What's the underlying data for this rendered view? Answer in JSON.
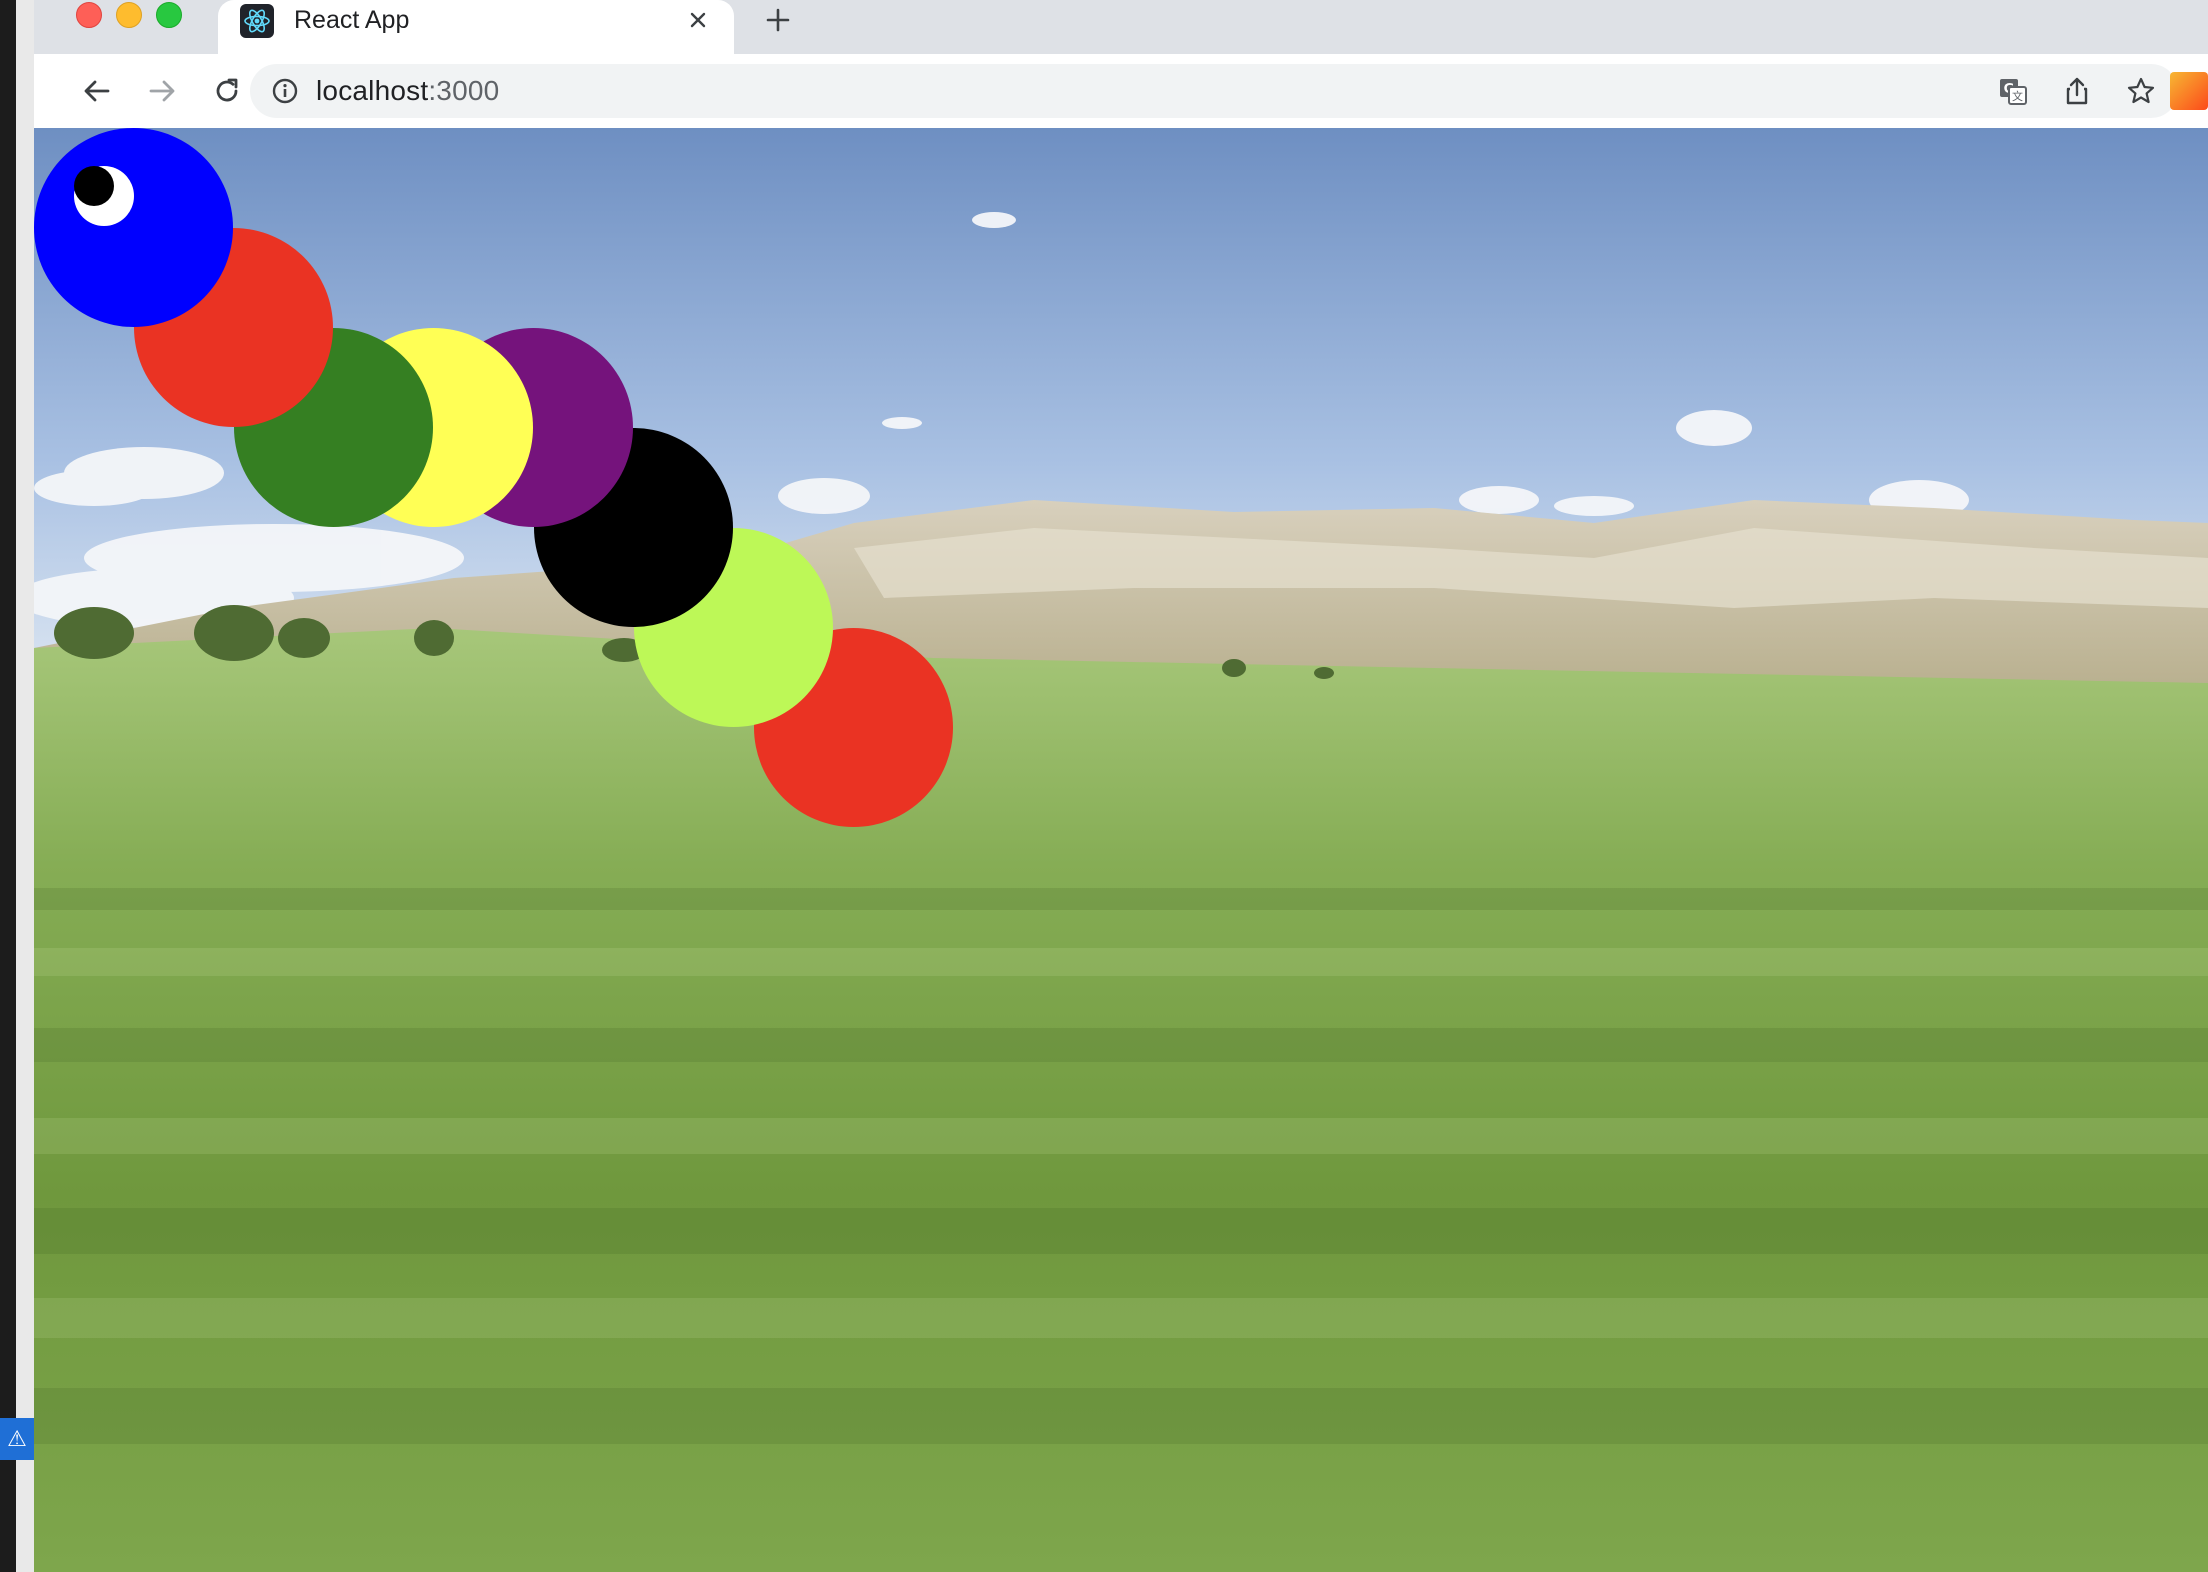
{
  "browser": {
    "tab": {
      "title": "React App",
      "favicon": "react-logo-icon"
    },
    "address": {
      "host": "localhost",
      "port": ":3000"
    },
    "icons": {
      "back": "back-arrow-icon",
      "forward": "forward-arrow-icon",
      "reload": "reload-icon",
      "info": "info-icon",
      "translate": "translate-icon",
      "share": "share-icon",
      "bookmark": "star-icon",
      "close": "close-icon",
      "new_tab": "plus-icon"
    }
  },
  "page": {
    "background": "grassland with cliffs and blue sky",
    "caterpillar": {
      "segments": [
        {
          "color": "#0000ff",
          "role": "head"
        },
        {
          "color": "#ea3323",
          "role": "body"
        },
        {
          "color": "#357f22",
          "role": "body"
        },
        {
          "color": "#ffff55",
          "role": "body"
        },
        {
          "color": "#75137c",
          "role": "body"
        },
        {
          "color": "#000000",
          "role": "body"
        },
        {
          "color": "#bdf857",
          "role": "body"
        },
        {
          "color": "#ea3323",
          "role": "body"
        }
      ],
      "eye_colors": {
        "white": "#ffffff",
        "pupil": "#000000"
      }
    }
  }
}
